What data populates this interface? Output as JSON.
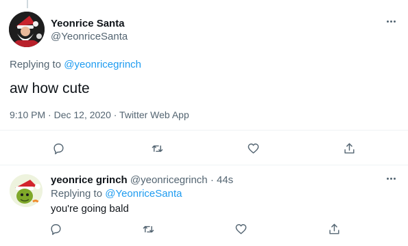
{
  "main_tweet": {
    "author_name": "Yeonrice Santa",
    "author_handle": "@YeonriceSanta",
    "replying_label": "Replying to",
    "replying_to": "@yeonricegrinch",
    "text": "aw how cute",
    "timestamp": "9:10 PM · Dec 12, 2020 · Twitter Web App"
  },
  "reply_tweet": {
    "author_name": "yeonrice grinch",
    "author_handle": "@yeonricegrinch",
    "age": "· 44s",
    "replying_label": "Replying to",
    "replying_to": "@YeonriceSanta",
    "text": "you're going bald"
  },
  "icons": [
    "more-icon",
    "reply-icon",
    "retweet-icon",
    "like-icon",
    "share-icon"
  ],
  "colors": {
    "link": "#1d9bf0",
    "muted": "#536471",
    "text": "#0f1419",
    "divider": "#eff3f4"
  }
}
